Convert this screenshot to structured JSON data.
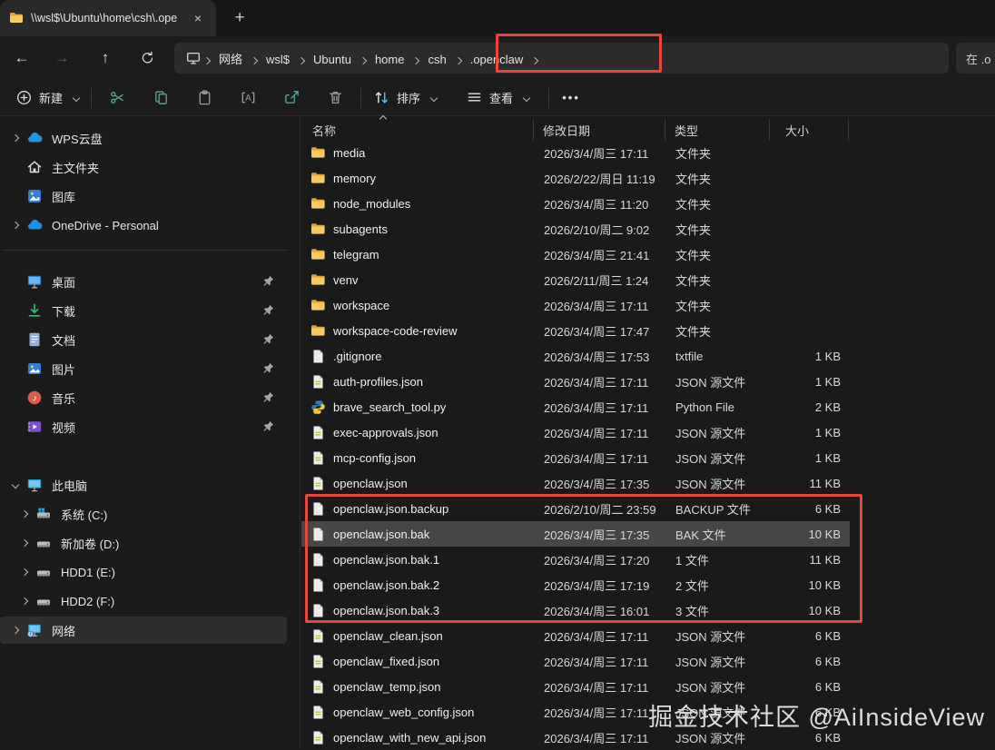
{
  "window": {
    "tab_title": "\\\\wsl$\\Ubuntu\\home\\csh\\.ope"
  },
  "nav": {
    "search_text": "在 .o",
    "breadcrumb": [
      "网络",
      "wsl$",
      "Ubuntu",
      "home",
      "csh",
      ".openclaw"
    ]
  },
  "toolbar": {
    "new_label": "新建",
    "sort_label": "排序",
    "view_label": "查看",
    "icons": [
      "cut",
      "copy",
      "paste",
      "rename",
      "share",
      "delete"
    ]
  },
  "sidebar": {
    "quick": [
      {
        "label": "WPS云盘",
        "icon": "cloud",
        "expandable": true
      },
      {
        "label": "主文件夹",
        "icon": "home"
      },
      {
        "label": "图库",
        "icon": "gallery"
      },
      {
        "label": "OneDrive - Personal",
        "icon": "onedrive",
        "expandable": true
      }
    ],
    "pinned": [
      {
        "label": "桌面",
        "icon": "desktop",
        "pinned": true
      },
      {
        "label": "下载",
        "icon": "download",
        "pinned": true
      },
      {
        "label": "文档",
        "icon": "document",
        "pinned": true
      },
      {
        "label": "图片",
        "icon": "pictures",
        "pinned": true
      },
      {
        "label": "音乐",
        "icon": "music",
        "pinned": true
      },
      {
        "label": "视频",
        "icon": "video",
        "pinned": true
      }
    ],
    "computer": {
      "label": "此电脑",
      "icon": "computer",
      "expanded": true,
      "drives": [
        {
          "label": "系统 (C:)",
          "icon": "drive-win"
        },
        {
          "label": "新加卷 (D:)",
          "icon": "drive"
        },
        {
          "label": "HDD1 (E:)",
          "icon": "drive"
        },
        {
          "label": "HDD2 (F:)",
          "icon": "drive"
        }
      ]
    },
    "network": {
      "label": "网络",
      "icon": "network",
      "selected": true
    }
  },
  "files": {
    "columns": [
      "名称",
      "修改日期",
      "类型",
      "大小"
    ],
    "rows": [
      {
        "name": "media",
        "icon": "folder",
        "date": "2026/3/4/周三 17:11",
        "type": "文件夹",
        "size": ""
      },
      {
        "name": "memory",
        "icon": "folder",
        "date": "2026/2/22/周日 11:19",
        "type": "文件夹",
        "size": ""
      },
      {
        "name": "node_modules",
        "icon": "folder",
        "date": "2026/3/4/周三 11:20",
        "type": "文件夹",
        "size": ""
      },
      {
        "name": "subagents",
        "icon": "folder",
        "date": "2026/2/10/周二 9:02",
        "type": "文件夹",
        "size": ""
      },
      {
        "name": "telegram",
        "icon": "folder",
        "date": "2026/3/4/周三 21:41",
        "type": "文件夹",
        "size": ""
      },
      {
        "name": "venv",
        "icon": "folder",
        "date": "2026/2/11/周三 1:24",
        "type": "文件夹",
        "size": ""
      },
      {
        "name": "workspace",
        "icon": "folder",
        "date": "2026/3/4/周三 17:11",
        "type": "文件夹",
        "size": ""
      },
      {
        "name": "workspace-code-review",
        "icon": "folder",
        "date": "2026/3/4/周三 17:47",
        "type": "文件夹",
        "size": ""
      },
      {
        "name": ".gitignore",
        "icon": "file",
        "date": "2026/3/4/周三 17:53",
        "type": "txtfile",
        "size": "1 KB"
      },
      {
        "name": "auth-profiles.json",
        "icon": "json",
        "date": "2026/3/4/周三 17:11",
        "type": "JSON 源文件",
        "size": "1 KB"
      },
      {
        "name": "brave_search_tool.py",
        "icon": "python",
        "date": "2026/3/4/周三 17:11",
        "type": "Python File",
        "size": "2 KB"
      },
      {
        "name": "exec-approvals.json",
        "icon": "json",
        "date": "2026/3/4/周三 17:11",
        "type": "JSON 源文件",
        "size": "1 KB"
      },
      {
        "name": "mcp-config.json",
        "icon": "json",
        "date": "2026/3/4/周三 17:11",
        "type": "JSON 源文件",
        "size": "1 KB"
      },
      {
        "name": "openclaw.json",
        "icon": "json",
        "date": "2026/3/4/周三 17:35",
        "type": "JSON 源文件",
        "size": "11 KB"
      },
      {
        "name": "openclaw.json.backup",
        "icon": "file",
        "date": "2026/2/10/周二 23:59",
        "type": "BACKUP 文件",
        "size": "6 KB"
      },
      {
        "name": "openclaw.json.bak",
        "icon": "file",
        "date": "2026/3/4/周三 17:35",
        "type": "BAK 文件",
        "size": "10 KB",
        "selected": true
      },
      {
        "name": "openclaw.json.bak.1",
        "icon": "file",
        "date": "2026/3/4/周三 17:20",
        "type": "1 文件",
        "size": "11 KB"
      },
      {
        "name": "openclaw.json.bak.2",
        "icon": "file",
        "date": "2026/3/4/周三 17:19",
        "type": "2 文件",
        "size": "10 KB"
      },
      {
        "name": "openclaw.json.bak.3",
        "icon": "file",
        "date": "2026/3/4/周三 16:01",
        "type": "3 文件",
        "size": "10 KB"
      },
      {
        "name": "openclaw_clean.json",
        "icon": "json",
        "date": "2026/3/4/周三 17:11",
        "type": "JSON 源文件",
        "size": "6 KB"
      },
      {
        "name": "openclaw_fixed.json",
        "icon": "json",
        "date": "2026/3/4/周三 17:11",
        "type": "JSON 源文件",
        "size": "6 KB"
      },
      {
        "name": "openclaw_temp.json",
        "icon": "json",
        "date": "2026/3/4/周三 17:11",
        "type": "JSON 源文件",
        "size": "6 KB"
      },
      {
        "name": "openclaw_web_config.json",
        "icon": "json",
        "date": "2026/3/4/周三 17:11",
        "type": "JSON 源文件",
        "size": "6 KB"
      },
      {
        "name": "openclaw_with_new_api.json",
        "icon": "json",
        "date": "2026/3/4/周三 17:11",
        "type": "JSON 源文件",
        "size": "6 KB"
      }
    ]
  },
  "annotation": {
    "color": "#e8453c",
    "boxed_rows_from": "openclaw.json.backup",
    "boxed_rows_to": "openclaw.json.bak.3"
  },
  "watermark": "掘金技术社区 @AiInsideView",
  "colors": {
    "selection": "#464646",
    "folder": "#f3c64d",
    "accent_blue": "#4cc2ff"
  }
}
